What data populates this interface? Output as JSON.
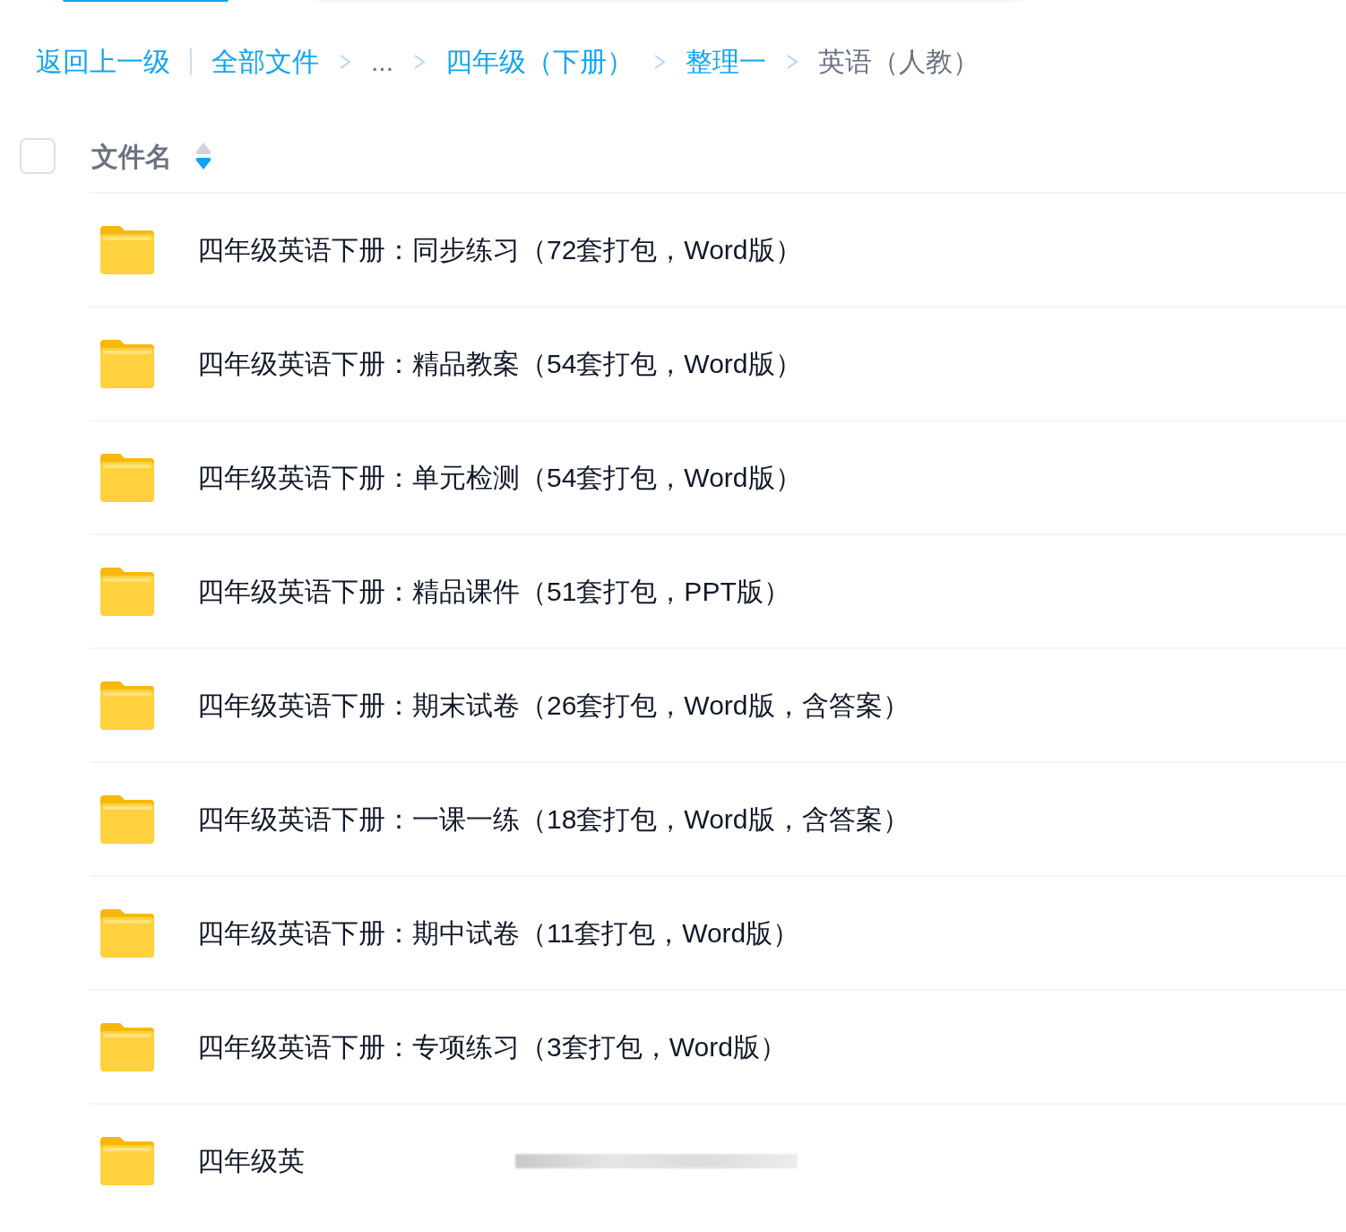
{
  "breadcrumb": [
    {
      "label": "返回上一级",
      "kind": "link"
    },
    {
      "label": "全部文件",
      "kind": "link"
    },
    {
      "label": "...",
      "kind": "ellipsis"
    },
    {
      "label": "四年级（下册）",
      "kind": "link"
    },
    {
      "label": "整理一",
      "kind": "link"
    },
    {
      "label": "英语（人教）",
      "kind": "current"
    }
  ],
  "header": {
    "select_all_checked": false,
    "column": "文件名",
    "sort_descending": true
  },
  "rows": [
    {
      "name": "四年级英语下册：同步练习（72套打包，Word版）",
      "kind": "folder"
    },
    {
      "name": "四年级英语下册：精品教案（54套打包，Word版）",
      "kind": "folder"
    },
    {
      "name": "四年级英语下册：单元检测（54套打包，Word版）",
      "kind": "folder"
    },
    {
      "name": "四年级英语下册：精品课件（51套打包，PPT版）",
      "kind": "folder"
    },
    {
      "name": "四年级英语下册：期末试卷（26套打包，Word版，含答案）",
      "kind": "folder"
    },
    {
      "name": "四年级英语下册：一课一练（18套打包，Word版，含答案）",
      "kind": "folder"
    },
    {
      "name": "四年级英语下册：期中试卷（11套打包，Word版）",
      "kind": "folder"
    },
    {
      "name": "四年级英语下册：专项练习（3套打包，Word版）",
      "kind": "folder"
    },
    {
      "name": "四年级英",
      "kind": "folder",
      "blurred": true
    }
  ]
}
